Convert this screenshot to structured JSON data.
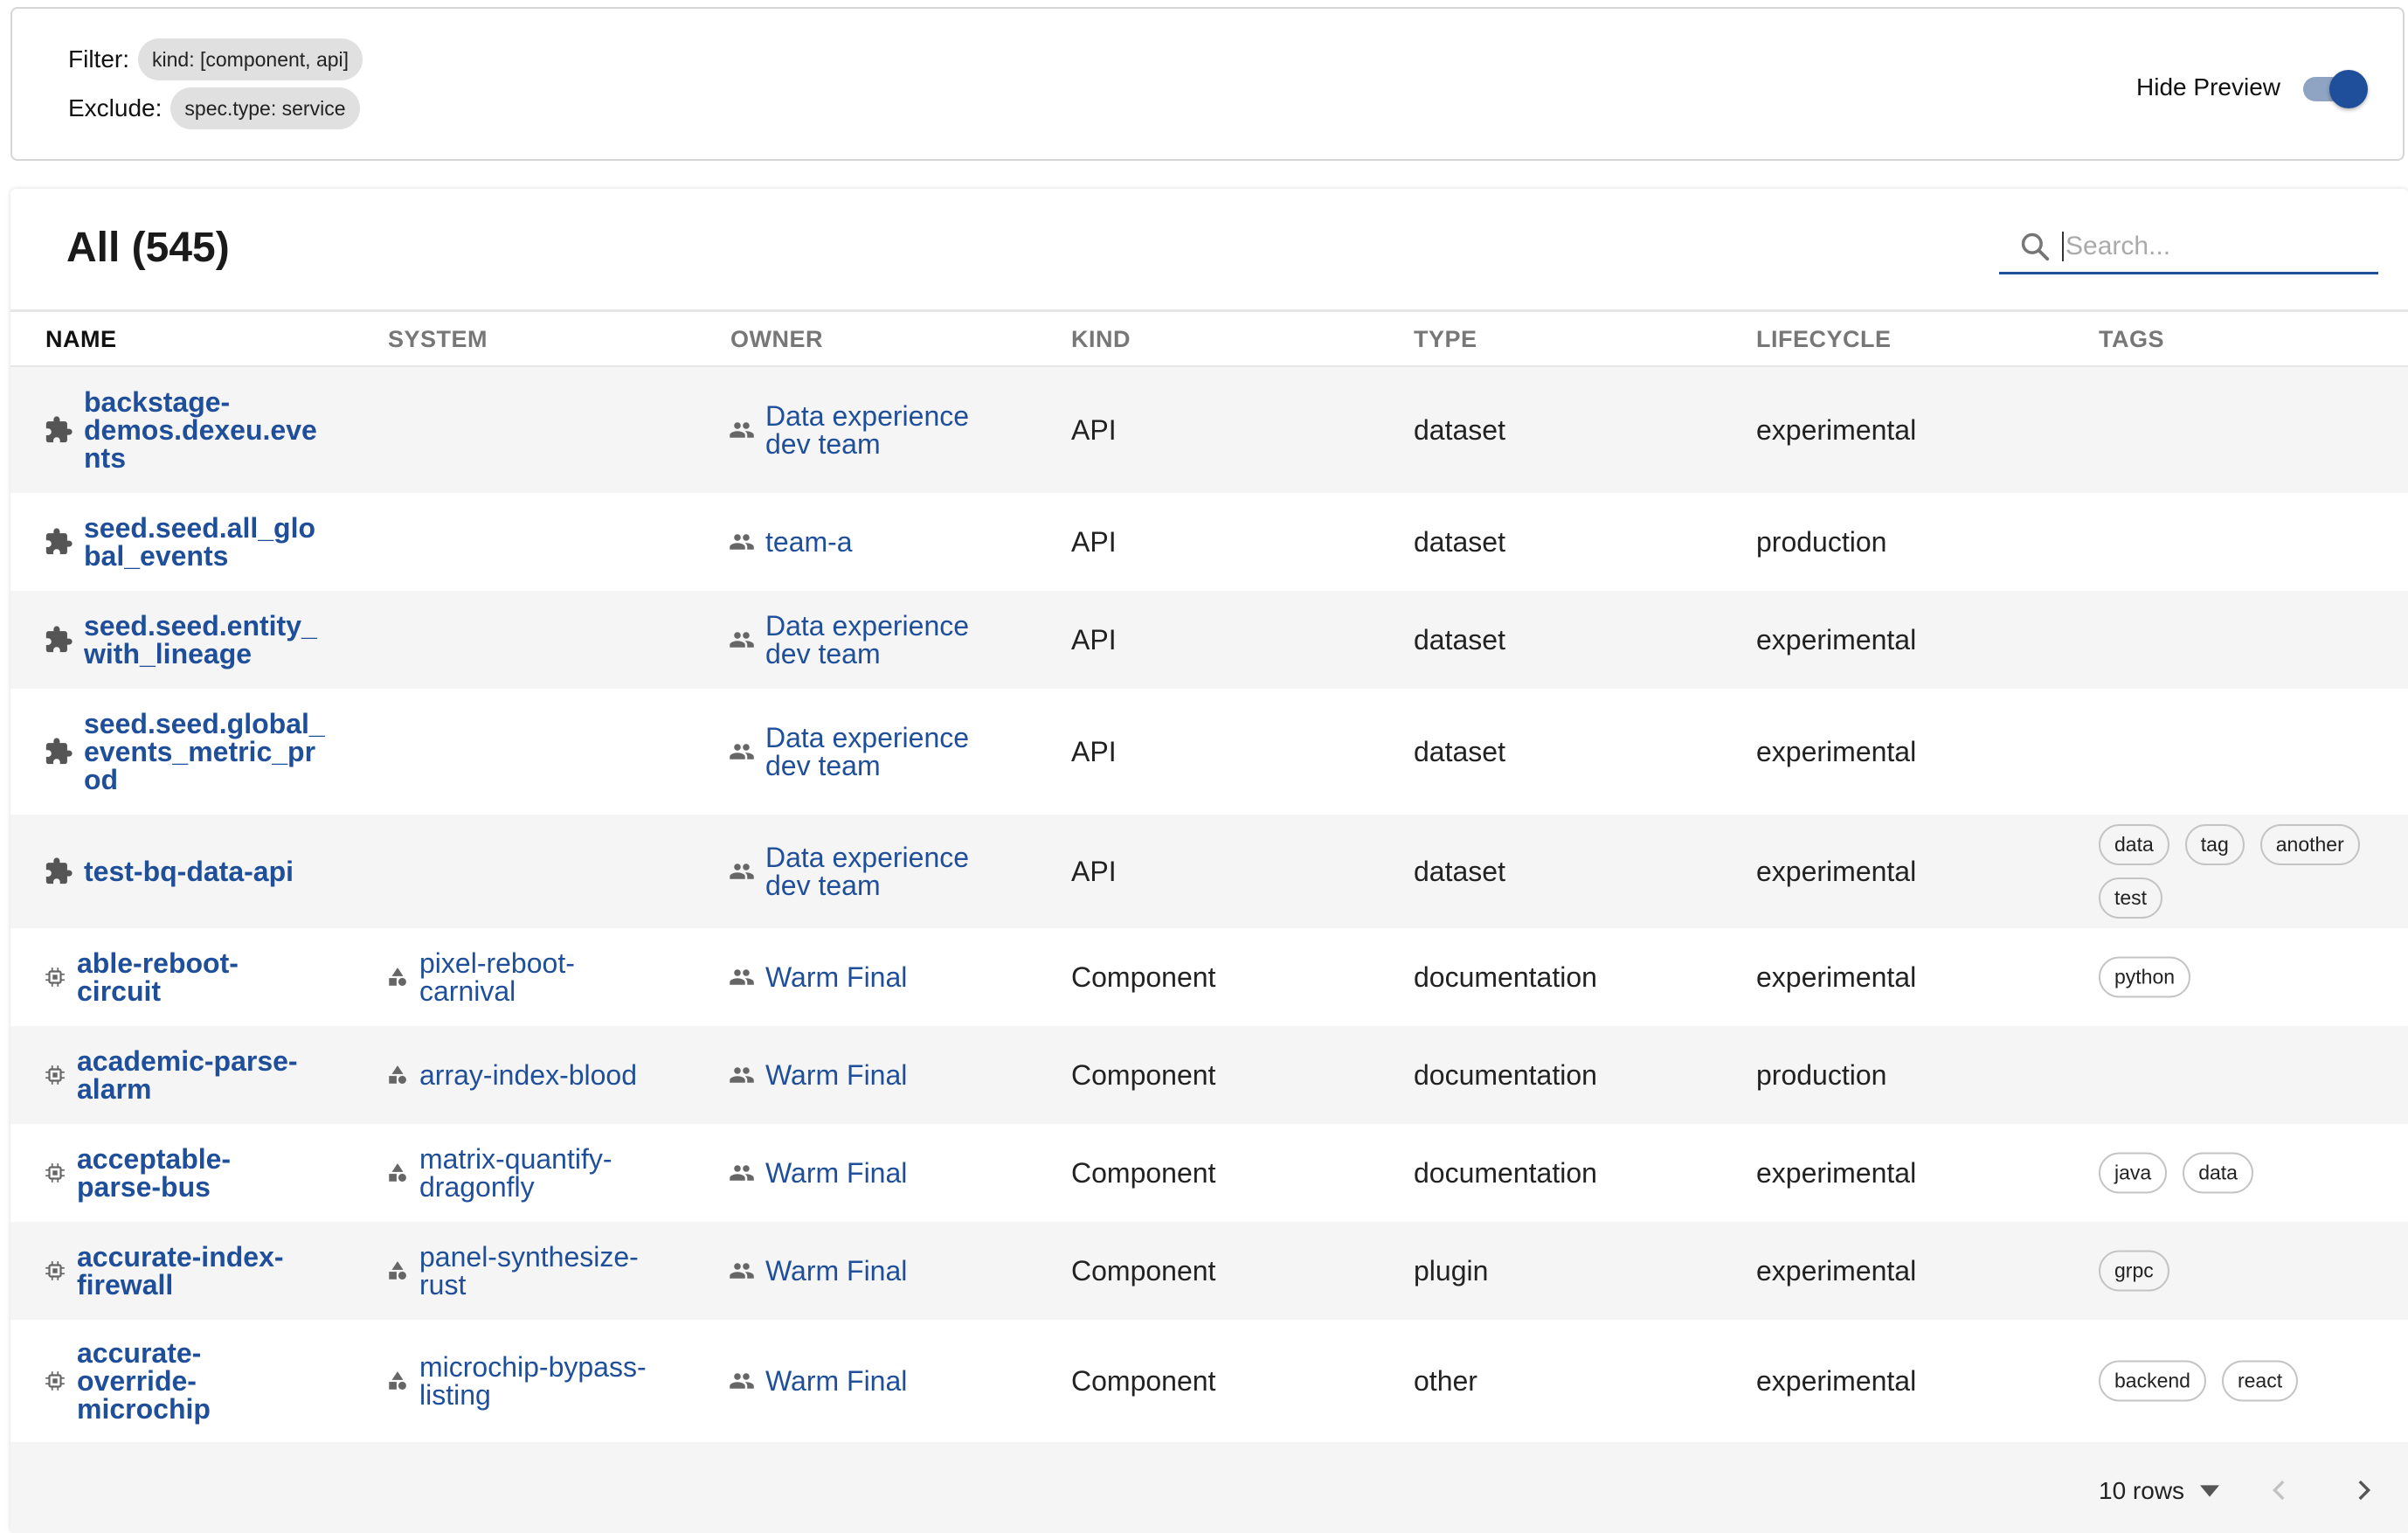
{
  "filters": {
    "filter_label": "Filter:",
    "filter_chip": "kind: [component, api]",
    "exclude_label": "Exclude:",
    "exclude_chip": "spec.type: service",
    "hide_preview_label": "Hide Preview",
    "hide_preview_on": true
  },
  "table": {
    "title": "All (545)",
    "search_placeholder": "Search...",
    "columns": {
      "name": "NAME",
      "system": "SYSTEM",
      "owner": "OWNER",
      "kind": "KIND",
      "type": "TYPE",
      "lifecycle": "LIFECYCLE",
      "tags": "TAGS"
    },
    "rows": [
      {
        "name": "backstage-demos.dexeu.events",
        "name_icon": "puzzle-icon",
        "system": "",
        "owner": "Data experience dev team",
        "kind": "API",
        "type": "dataset",
        "lifecycle": "experimental",
        "tags": []
      },
      {
        "name": "seed.seed.all_global_events",
        "name_icon": "puzzle-icon",
        "system": "",
        "owner": "team-a",
        "kind": "API",
        "type": "dataset",
        "lifecycle": "production",
        "tags": []
      },
      {
        "name": "seed.seed.entity_with_lineage",
        "name_icon": "puzzle-icon",
        "system": "",
        "owner": "Data experience dev team",
        "kind": "API",
        "type": "dataset",
        "lifecycle": "experimental",
        "tags": []
      },
      {
        "name": "seed.seed.global_events_metric_prod",
        "name_icon": "puzzle-icon",
        "system": "",
        "owner": "Data experience dev team",
        "kind": "API",
        "type": "dataset",
        "lifecycle": "experimental",
        "tags": []
      },
      {
        "name": "test-bq-data-api",
        "name_icon": "puzzle-icon",
        "system": "",
        "owner": "Data experience dev team",
        "kind": "API",
        "type": "dataset",
        "lifecycle": "experimental",
        "tags": [
          "data",
          "tag",
          "another",
          "test"
        ]
      },
      {
        "name": "able-reboot-circuit",
        "name_icon": "chip-icon",
        "system": "pixel-reboot-carnival",
        "owner": "Warm Final",
        "kind": "Component",
        "type": "documentation",
        "lifecycle": "experimental",
        "tags": [
          "python"
        ]
      },
      {
        "name": "academic-parse-alarm",
        "name_icon": "chip-icon",
        "system": "array-index-blood",
        "owner": "Warm Final",
        "kind": "Component",
        "type": "documentation",
        "lifecycle": "production",
        "tags": []
      },
      {
        "name": "acceptable-parse-bus",
        "name_icon": "chip-icon",
        "system": "matrix-quantify-dragonfly",
        "owner": "Warm Final",
        "kind": "Component",
        "type": "documentation",
        "lifecycle": "experimental",
        "tags": [
          "java",
          "data"
        ]
      },
      {
        "name": "accurate-index-firewall",
        "name_icon": "chip-icon",
        "system": "panel-synthesize-rust",
        "owner": "Warm Final",
        "kind": "Component",
        "type": "plugin",
        "lifecycle": "experimental",
        "tags": [
          "grpc"
        ]
      },
      {
        "name": "accurate-override-microchip",
        "name_icon": "chip-icon",
        "system": "microchip-bypass-listing",
        "owner": "Warm Final",
        "kind": "Component",
        "type": "other",
        "lifecycle": "experimental",
        "tags": [
          "backend",
          "react"
        ]
      }
    ],
    "name_lines": [
      [
        "backstage-",
        "demos.dexeu.eve",
        "nts"
      ],
      [
        "seed.seed.all_glo",
        "bal_events"
      ],
      [
        "seed.seed.entity_",
        "with_lineage"
      ],
      [
        "seed.seed.global_",
        "events_metric_pr",
        "od"
      ],
      [
        "test-bq-data-api"
      ],
      [
        "able-reboot-",
        "circuit"
      ],
      [
        "academic-parse-",
        "alarm"
      ],
      [
        "acceptable-",
        "parse-bus"
      ],
      [
        "accurate-index-",
        "firewall"
      ],
      [
        "accurate-",
        "override-",
        "microchip"
      ]
    ],
    "system_lines": [
      [],
      [],
      [],
      [],
      [],
      [
        "pixel-reboot-",
        "carnival"
      ],
      [
        "array-index-blood"
      ],
      [
        "matrix-quantify-",
        "dragonfly"
      ],
      [
        "panel-synthesize-",
        "rust"
      ],
      [
        "microchip-bypass-",
        "listing"
      ]
    ],
    "owner_lines": [
      [
        "Data experience",
        "dev team"
      ],
      [
        "team-a"
      ],
      [
        "Data experience",
        "dev team"
      ],
      [
        "Data experience",
        "dev team"
      ],
      [
        "Data experience",
        "dev team"
      ],
      [
        "Warm Final"
      ],
      [
        "Warm Final"
      ],
      [
        "Warm Final"
      ],
      [
        "Warm Final"
      ],
      [
        "Warm Final"
      ]
    ]
  },
  "pagination": {
    "rows_per_page": "10 rows"
  },
  "colors": {
    "link": "#1f4f9a",
    "row_alt": "#f5f5f5",
    "toggle": "#1f4f9a"
  }
}
